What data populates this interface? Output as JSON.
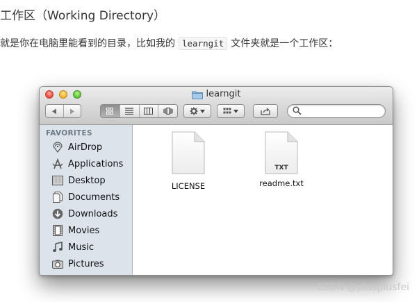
{
  "heading": "工作区（Working Directory）",
  "paragraph": {
    "before": "就是你在电脑里能看到的目录，比如我的",
    "code": "learngit",
    "after": "文件夹就是一个工作区："
  },
  "finder": {
    "title": "learngit",
    "sidebar": {
      "header": "FAVORITES",
      "items": [
        {
          "label": "AirDrop",
          "icon": "airdrop-icon"
        },
        {
          "label": "Applications",
          "icon": "applications-icon"
        },
        {
          "label": "Desktop",
          "icon": "desktop-icon"
        },
        {
          "label": "Documents",
          "icon": "documents-icon"
        },
        {
          "label": "Downloads",
          "icon": "downloads-icon"
        },
        {
          "label": "Movies",
          "icon": "movies-icon"
        },
        {
          "label": "Music",
          "icon": "music-icon"
        },
        {
          "label": "Pictures",
          "icon": "pictures-icon"
        }
      ]
    },
    "files": [
      {
        "name": "LICENSE",
        "badge": ""
      },
      {
        "name": "readme.txt",
        "badge": "TXT"
      }
    ],
    "view_mode": "icon"
  },
  "watermark": "CSDN @plusplusfei"
}
